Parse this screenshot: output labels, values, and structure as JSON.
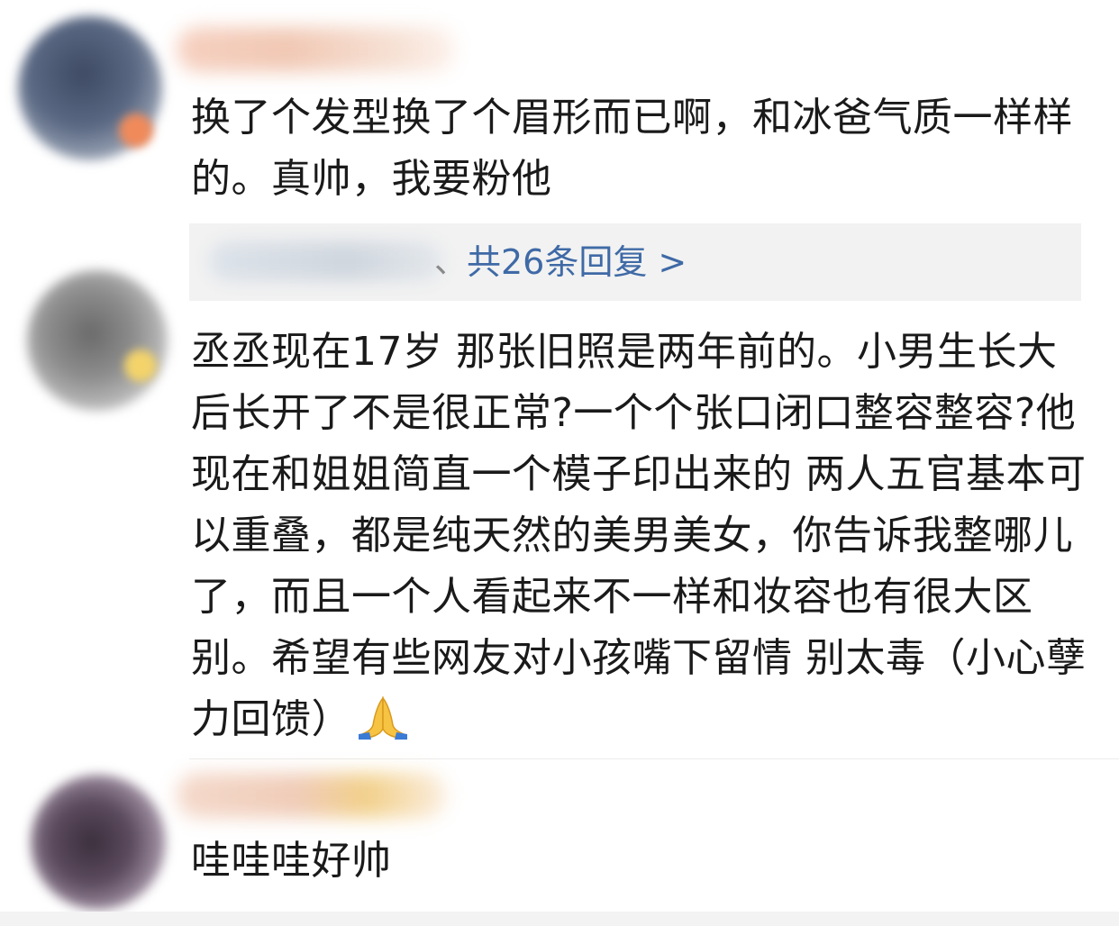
{
  "comments": [
    {
      "text": "换了个发型换了个眉形而已啊，和冰爸气质一样样的。真帅，我要粉他",
      "reply_separator": "、",
      "reply_link": "共26条回复 >"
    },
    {
      "text": "丞丞现在17岁 那张旧照是两年前的。小男生长大后长开了不是很正常?一个个张口闭口整容整容?他现在和姐姐简直一个模子印出来的 两人五官基本可以重叠，都是纯天然的美男美女，你告诉我整哪儿了，而且一个人看起来不一样和妆容也有很大区别。希望有些网友对小孩嘴下留情 别太毒（小心孽力回馈）",
      "emoji": "folded-hands"
    },
    {
      "text": "哇哇哇好帅"
    }
  ],
  "colors": {
    "link": "#3f6aa6",
    "reply_bg": "#f2f2f2",
    "text": "#1a1a1a"
  }
}
